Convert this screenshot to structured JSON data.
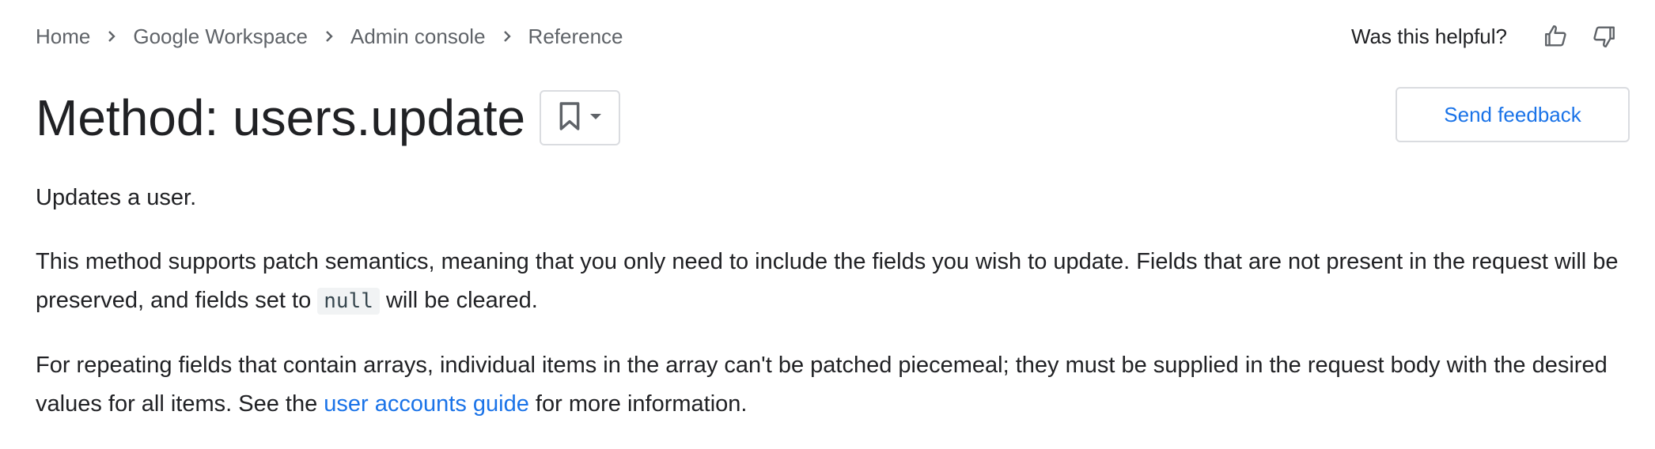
{
  "breadcrumb": {
    "items": [
      "Home",
      "Google Workspace",
      "Admin console",
      "Reference"
    ]
  },
  "feedback": {
    "question": "Was this helpful?",
    "thumb_up_icon": "thumb-up-icon",
    "thumb_down_icon": "thumb-down-icon",
    "send_label": "Send feedback"
  },
  "header": {
    "title": "Method: users.update",
    "bookmark_icon": "bookmark-icon",
    "dropdown_icon": "caret-down-icon"
  },
  "content": {
    "p1": "Updates a user.",
    "p2_before": "This method supports patch semantics, meaning that you only need to include the fields you wish to update. Fields that are not present in the request will be preserved, and fields set to ",
    "p2_code": "null",
    "p2_after": " will be cleared.",
    "p3_before": "For repeating fields that contain arrays, individual items in the array can't be patched piecemeal; they must be supplied in the request body with the desired values for all items. See the ",
    "p3_link": "user accounts guide",
    "p3_after": " for more information."
  },
  "colors": {
    "link": "#1a73e8",
    "text": "#202124",
    "muted": "#5f6368",
    "border": "#dadce0"
  }
}
